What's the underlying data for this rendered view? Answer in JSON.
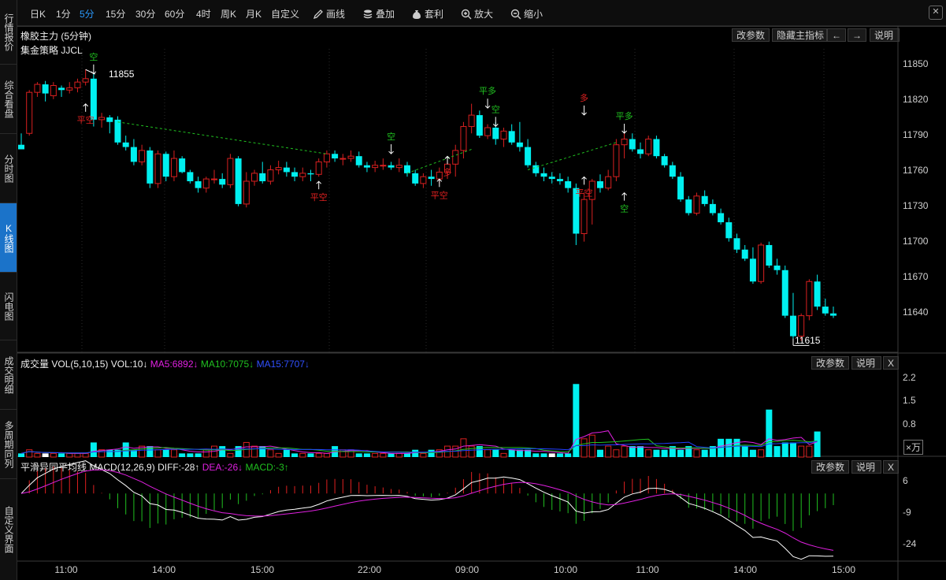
{
  "sidebar": {
    "items": [
      {
        "label": "行情报价"
      },
      {
        "label": "综合看盘"
      },
      {
        "label": "分时图"
      },
      {
        "label": "K线图"
      },
      {
        "label": "闪电图"
      },
      {
        "label": "成交明细"
      },
      {
        "label": "多周期同列"
      },
      {
        "label": "自定义界面"
      }
    ]
  },
  "toolbar": {
    "periods": [
      "日K",
      "1分",
      "5分",
      "15分",
      "30分",
      "60分",
      "4时",
      "周K",
      "月K",
      "自定义"
    ],
    "active_period": "5分",
    "tools": [
      "画线",
      "叠加",
      "套利",
      "放大",
      "缩小"
    ],
    "close_label": "✕"
  },
  "main_panel": {
    "title": "橡胶主力 (5分钟)",
    "strategy": "集金策略  JJCL",
    "buttons": [
      "改参数",
      "隐藏主指标",
      "←",
      "→",
      "说明"
    ],
    "high_marker": "11855",
    "low_marker": "11615",
    "y_labels": [
      "11850",
      "11820",
      "11790",
      "11760",
      "11730",
      "11700",
      "11670",
      "11640"
    ]
  },
  "volume_panel": {
    "name": "成交量",
    "params": "VOL(5,10,15)",
    "vol": "VOL:10↓",
    "ma5": "MA5:6892↓",
    "ma10": "MA10:7075↓",
    "ma15": "MA15:7707↓",
    "buttons": [
      "改参数",
      "说明",
      "X"
    ],
    "y_labels": [
      "2.2",
      "1.5",
      "0.8"
    ],
    "unit": "×万"
  },
  "macd_panel": {
    "name": "平滑异同平均线",
    "params": "MACD(12,26,9)",
    "diff": "DIFF:-28↑",
    "dea": "DEA:-26↓",
    "macd": "MACD:-3↑",
    "buttons": [
      "改参数",
      "说明",
      "X"
    ],
    "y_labels": [
      "6",
      "-9",
      "-24"
    ]
  },
  "time_axis": [
    "11:00",
    "14:00",
    "15:00",
    "22:00",
    "09:00",
    "10:00",
    "11:00",
    "14:00",
    "15:00"
  ],
  "colors": {
    "up": "#d82020",
    "down": "#00f0f0",
    "ma5": "#e020e0",
    "ma10": "#20c020",
    "ma15": "#2040ff",
    "accent": "#1b73c9",
    "signal_red": "#e02020",
    "signal_green": "#20c020"
  },
  "chart_data": {
    "type": "candlestick",
    "ylim": [
      11610,
      11870
    ],
    "candles": [
      [
        11790,
        11800,
        11788,
        11786
      ],
      [
        11800,
        11838,
        11798,
        11836
      ],
      [
        11836,
        11845,
        11832,
        11843
      ],
      [
        11843,
        11846,
        11828,
        11835
      ],
      [
        11833,
        11845,
        11830,
        11842
      ],
      [
        11840,
        11842,
        11832,
        11838
      ],
      [
        11838,
        11845,
        11835,
        11840
      ],
      [
        11840,
        11848,
        11836,
        11845
      ],
      [
        11845,
        11856,
        11842,
        11848
      ],
      [
        11848,
        11852,
        11806,
        11812
      ],
      [
        11812,
        11818,
        11805,
        11814
      ],
      [
        11814,
        11816,
        11800,
        11810
      ],
      [
        11812,
        11815,
        11790,
        11792
      ],
      [
        11792,
        11798,
        11785,
        11788
      ],
      [
        11788,
        11795,
        11772,
        11775
      ],
      [
        11775,
        11790,
        11772,
        11785
      ],
      [
        11785,
        11788,
        11752,
        11756
      ],
      [
        11756,
        11785,
        11752,
        11782
      ],
      [
        11782,
        11784,
        11758,
        11762
      ],
      [
        11762,
        11785,
        11758,
        11778
      ],
      [
        11778,
        11780,
        11765,
        11766
      ],
      [
        11766,
        11768,
        11756,
        11758
      ],
      [
        11758,
        11762,
        11748,
        11752
      ],
      [
        11752,
        11762,
        11748,
        11760
      ],
      [
        11760,
        11768,
        11756,
        11760
      ],
      [
        11760,
        11765,
        11752,
        11755
      ],
      [
        11755,
        11782,
        11752,
        11778
      ],
      [
        11778,
        11780,
        11736,
        11738
      ],
      [
        11738,
        11766,
        11735,
        11758
      ],
      [
        11758,
        11768,
        11754,
        11765
      ],
      [
        11765,
        11775,
        11756,
        11758
      ],
      [
        11758,
        11772,
        11755,
        11768
      ],
      [
        11768,
        11776,
        11764,
        11770
      ],
      [
        11770,
        11775,
        11762,
        11766
      ],
      [
        11766,
        11770,
        11758,
        11762
      ],
      [
        11762,
        11770,
        11758,
        11765
      ],
      [
        11765,
        11768,
        11758,
        11764
      ],
      [
        11764,
        11778,
        11762,
        11775
      ],
      [
        11775,
        11785,
        11770,
        11782
      ],
      [
        11782,
        11785,
        11775,
        11778
      ],
      [
        11778,
        11782,
        11772,
        11778
      ],
      [
        11778,
        11785,
        11775,
        11780
      ],
      [
        11780,
        11784,
        11770,
        11772
      ],
      [
        11772,
        11775,
        11766,
        11770
      ],
      [
        11770,
        11776,
        11766,
        11772
      ],
      [
        11772,
        11778,
        11768,
        11772
      ],
      [
        11772,
        11775,
        11768,
        11770
      ],
      [
        11770,
        11778,
        11766,
        11772
      ],
      [
        11772,
        11775,
        11762,
        11765
      ],
      [
        11765,
        11768,
        11754,
        11756
      ],
      [
        11756,
        11765,
        11752,
        11762
      ],
      [
        11762,
        11768,
        11754,
        11760
      ],
      [
        11760,
        11770,
        11756,
        11766
      ],
      [
        11766,
        11778,
        11760,
        11773
      ],
      [
        11773,
        11790,
        11762,
        11785
      ],
      [
        11785,
        11810,
        11778,
        11806
      ],
      [
        11806,
        11826,
        11800,
        11816
      ],
      [
        11816,
        11820,
        11796,
        11798
      ],
      [
        11798,
        11808,
        11795,
        11805
      ],
      [
        11805,
        11810,
        11790,
        11795
      ],
      [
        11795,
        11805,
        11788,
        11802
      ],
      [
        11802,
        11808,
        11790,
        11792
      ],
      [
        11792,
        11810,
        11784,
        11788
      ],
      [
        11788,
        11795,
        11770,
        11772
      ],
      [
        11772,
        11775,
        11762,
        11765
      ],
      [
        11765,
        11770,
        11758,
        11762
      ],
      [
        11762,
        11766,
        11756,
        11760
      ],
      [
        11760,
        11765,
        11755,
        11758
      ],
      [
        11758,
        11762,
        11748,
        11752
      ],
      [
        11752,
        11756,
        11702,
        11712
      ],
      [
        11712,
        11748,
        11705,
        11742
      ],
      [
        11742,
        11760,
        11720,
        11758
      ],
      [
        11758,
        11764,
        11748,
        11752
      ],
      [
        11752,
        11768,
        11750,
        11762
      ],
      [
        11762,
        11795,
        11758,
        11790
      ],
      [
        11790,
        11800,
        11778,
        11795
      ],
      [
        11795,
        11800,
        11784,
        11786
      ],
      [
        11786,
        11792,
        11778,
        11782
      ],
      [
        11782,
        11798,
        11780,
        11795
      ],
      [
        11795,
        11798,
        11778,
        11780
      ],
      [
        11780,
        11782,
        11770,
        11772
      ],
      [
        11772,
        11775,
        11760,
        11762
      ],
      [
        11762,
        11766,
        11740,
        11742
      ],
      [
        11742,
        11745,
        11728,
        11730
      ],
      [
        11730,
        11748,
        11728,
        11745
      ],
      [
        11745,
        11750,
        11736,
        11738
      ],
      [
        11738,
        11742,
        11728,
        11730
      ],
      [
        11730,
        11734,
        11720,
        11722
      ],
      [
        11722,
        11726,
        11705,
        11708
      ],
      [
        11708,
        11712,
        11695,
        11698
      ],
      [
        11698,
        11702,
        11688,
        11690
      ],
      [
        11690,
        11700,
        11668,
        11670
      ],
      [
        11670,
        11704,
        11668,
        11702
      ],
      [
        11702,
        11705,
        11682,
        11684
      ],
      [
        11684,
        11690,
        11676,
        11680
      ],
      [
        11680,
        11684,
        11638,
        11640
      ],
      [
        11640,
        11660,
        11620,
        11622
      ],
      [
        11622,
        11642,
        11618,
        11640
      ],
      [
        11640,
        11672,
        11636,
        11670
      ],
      [
        11670,
        11676,
        11645,
        11648
      ],
      [
        11648,
        11655,
        11640,
        11642
      ],
      [
        11642,
        11648,
        11638,
        11640
      ]
    ],
    "volume": [
      [
        1,
        1
      ],
      [
        0,
        2
      ],
      [
        1,
        1
      ],
      [
        0,
        1
      ],
      [
        1,
        1
      ],
      [
        0,
        1
      ],
      [
        1,
        1
      ],
      [
        0,
        1
      ],
      [
        1,
        1
      ],
      [
        0,
        4
      ],
      [
        1,
        2
      ],
      [
        0,
        2
      ],
      [
        1,
        2
      ],
      [
        0,
        4
      ],
      [
        1,
        2
      ],
      [
        0,
        3
      ],
      [
        1,
        3
      ],
      [
        0,
        2
      ],
      [
        1,
        2
      ],
      [
        0,
        2
      ],
      [
        1,
        1
      ],
      [
        0,
        1
      ],
      [
        1,
        1
      ],
      [
        0,
        2
      ],
      [
        1,
        3
      ],
      [
        0,
        3
      ],
      [
        1,
        1
      ],
      [
        0,
        3
      ],
      [
        1,
        4
      ],
      [
        0,
        3
      ],
      [
        1,
        3
      ],
      [
        0,
        2
      ],
      [
        1,
        1
      ],
      [
        0,
        2
      ],
      [
        1,
        1
      ],
      [
        0,
        1
      ],
      [
        1,
        1
      ],
      [
        0,
        1
      ],
      [
        1,
        1
      ],
      [
        0,
        3
      ],
      [
        1,
        2
      ],
      [
        0,
        2
      ],
      [
        1,
        1
      ],
      [
        0,
        1
      ],
      [
        1,
        1
      ],
      [
        0,
        1
      ],
      [
        1,
        1
      ],
      [
        0,
        1
      ],
      [
        1,
        1
      ],
      [
        0,
        2
      ],
      [
        1,
        1
      ],
      [
        0,
        2
      ],
      [
        1,
        2
      ],
      [
        0,
        3
      ],
      [
        1,
        3
      ],
      [
        0,
        5
      ],
      [
        1,
        3
      ],
      [
        0,
        3
      ],
      [
        1,
        2
      ],
      [
        0,
        2
      ],
      [
        1,
        1
      ],
      [
        0,
        2
      ],
      [
        1,
        2
      ],
      [
        0,
        2
      ],
      [
        1,
        1
      ],
      [
        0,
        1
      ],
      [
        1,
        1
      ],
      [
        0,
        1
      ],
      [
        1,
        1
      ],
      [
        0,
        20
      ],
      [
        1,
        5
      ],
      [
        0,
        6
      ],
      [
        1,
        2
      ],
      [
        0,
        3
      ],
      [
        1,
        2
      ],
      [
        0,
        3
      ],
      [
        1,
        3
      ],
      [
        0,
        3
      ],
      [
        1,
        2
      ],
      [
        0,
        2
      ],
      [
        1,
        2
      ],
      [
        0,
        3
      ],
      [
        1,
        2
      ],
      [
        0,
        3
      ],
      [
        1,
        2
      ],
      [
        0,
        2
      ],
      [
        1,
        3
      ],
      [
        0,
        5
      ],
      [
        1,
        5
      ],
      [
        0,
        5
      ],
      [
        1,
        3
      ],
      [
        0,
        2
      ],
      [
        1,
        2
      ],
      [
        0,
        13
      ],
      [
        1,
        3
      ],
      [
        0,
        4
      ],
      [
        1,
        4
      ],
      [
        0,
        3
      ],
      [
        1,
        3
      ],
      [
        0,
        7
      ]
    ],
    "macd": {
      "diff_end": -28,
      "dea_end": -26,
      "macd_end": -3,
      "ylim": [
        -32,
        10
      ]
    }
  }
}
